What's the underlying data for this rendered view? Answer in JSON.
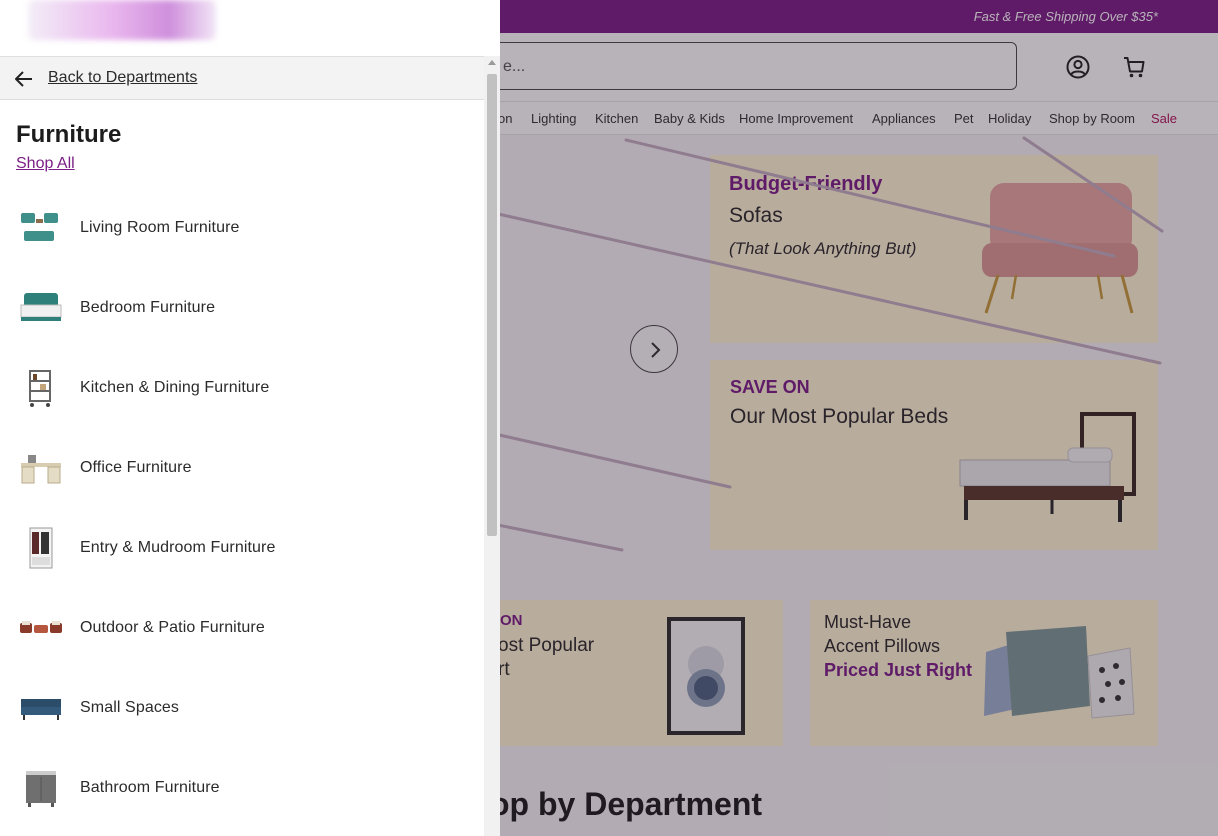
{
  "header": {
    "promo": "Fast & Free Shipping Over $35*",
    "search_placeholder": "e...",
    "account_icon": "account-icon",
    "cart_icon": "cart-icon"
  },
  "nav": {
    "items": [
      "on",
      "Lighting",
      "Kitchen",
      "Baby & Kids",
      "Home Improvement",
      "Appliances",
      "Pet",
      "Holiday",
      "Shop by Room",
      "Sale"
    ],
    "sale_color": "#b0185a"
  },
  "banners": {
    "sofas": {
      "headline": "Budget-Friendly",
      "line2": "Sofas",
      "line3": "(That Look Anything But)"
    },
    "beds": {
      "headline": "SAVE ON",
      "line2": "Our Most Popular Beds"
    },
    "art": {
      "headline": "ON",
      "line2": "ost Popular",
      "line3": "rt"
    },
    "pillows": {
      "line1": "Must-Have",
      "line2": "Accent Pillows",
      "headline": "Priced Just Right"
    }
  },
  "department_heading": "op by Department",
  "drawer": {
    "back_label": "Back to Departments",
    "title": "Furniture",
    "shop_all": "Shop All",
    "categories": [
      {
        "label": "Living Room Furniture",
        "icon": "sofa-set-icon"
      },
      {
        "label": "Bedroom Furniture",
        "icon": "bed-icon"
      },
      {
        "label": "Kitchen & Dining Furniture",
        "icon": "bar-cart-icon"
      },
      {
        "label": "Office Furniture",
        "icon": "desk-icon"
      },
      {
        "label": "Entry & Mudroom Furniture",
        "icon": "hall-tree-icon"
      },
      {
        "label": "Outdoor & Patio Furniture",
        "icon": "patio-set-icon"
      },
      {
        "label": "Small Spaces",
        "icon": "futon-icon"
      },
      {
        "label": "Bathroom Furniture",
        "icon": "vanity-icon"
      }
    ]
  },
  "colors": {
    "brand_purple": "#7b1f86",
    "banner_cream": "#fff7d6",
    "overlay": "rgba(38,22,42,0.33)"
  }
}
